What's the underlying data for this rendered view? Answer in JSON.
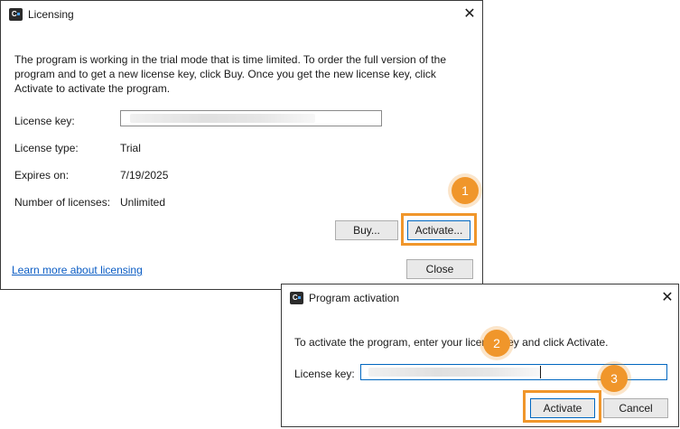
{
  "licensing": {
    "title": "Licensing",
    "description": "The program is working in the trial mode that is time limited. To order the full version of the program and to get a new license key, click Buy. Once you get the new license key, click Activate to activate the program.",
    "description_lines": [
      "The program is working in the trial mode that is time limited. To order the full version of the",
      "program and to get a new license key, click Buy. Once you get the new license key, click",
      "Activate to activate the program."
    ],
    "fields": [
      {
        "label": "License key:",
        "value": ""
      },
      {
        "label": "License type:",
        "value": "Trial"
      },
      {
        "label": "Expires on:",
        "value": "7/19/2025"
      },
      {
        "label": "Number of licenses:",
        "value": "Unlimited"
      }
    ],
    "buy_label": "Buy...",
    "activate_label": "Activate...",
    "close_label": "Close",
    "learn_more": "Learn more about licensing",
    "close_glyph": "✕"
  },
  "activation": {
    "title": "Program activation",
    "instruction": "To activate the program, enter your license key and click Activate.",
    "key_label": "License key:",
    "activate_label": "Activate",
    "cancel_label": "Cancel",
    "close_glyph": "✕"
  },
  "callouts": [
    "1",
    "2",
    "3"
  ],
  "colors": {
    "accent": "#f0962b",
    "link": "#0a5cc4",
    "focus": "#0067c0"
  },
  "icons": {
    "app": "app-logo-icon",
    "close": "close-icon"
  }
}
